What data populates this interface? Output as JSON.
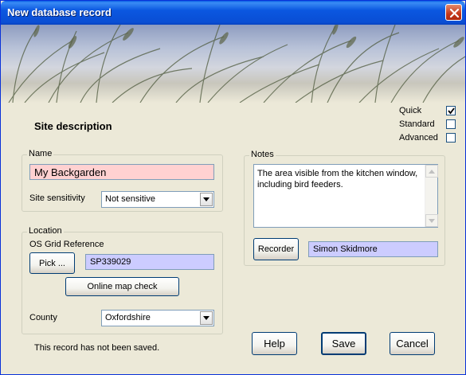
{
  "window": {
    "title": "New database record"
  },
  "icons": {
    "close": "close-icon",
    "dropdown": "chevron-down-icon",
    "check": "check-icon",
    "scroll_up": "scroll-up-icon",
    "scroll_down": "scroll-down-icon"
  },
  "mode": {
    "options": [
      {
        "label": "Quick",
        "checked": true
      },
      {
        "label": "Standard",
        "checked": false
      },
      {
        "label": "Advanced",
        "checked": false
      }
    ]
  },
  "heading": "Site description",
  "name_group": {
    "legend": "Name",
    "name_value": "My Backgarden",
    "sensitivity_label": "Site sensitivity",
    "sensitivity_value": "Not sensitive"
  },
  "location_group": {
    "legend": "Location",
    "grid_ref_label": "OS Grid Reference",
    "pick_button": "Pick ...",
    "grid_ref_value": "SP339029",
    "map_check_button": "Online map check",
    "county_label": "County",
    "county_value": "Oxfordshire"
  },
  "notes_group": {
    "legend": "Notes",
    "notes_text": "The area visible from the kitchen window, including bird feeders.",
    "recorder_button": "Recorder",
    "recorder_value": "Simon Skidmore"
  },
  "status": "This record has not been saved.",
  "buttons": {
    "help": "Help",
    "save": "Save",
    "cancel": "Cancel"
  },
  "colors": {
    "title_bar": "#0a52dc",
    "name_field": "#ffd1d1",
    "lookup_field": "#ccccff",
    "dialog_bg": "#ece9d8"
  }
}
